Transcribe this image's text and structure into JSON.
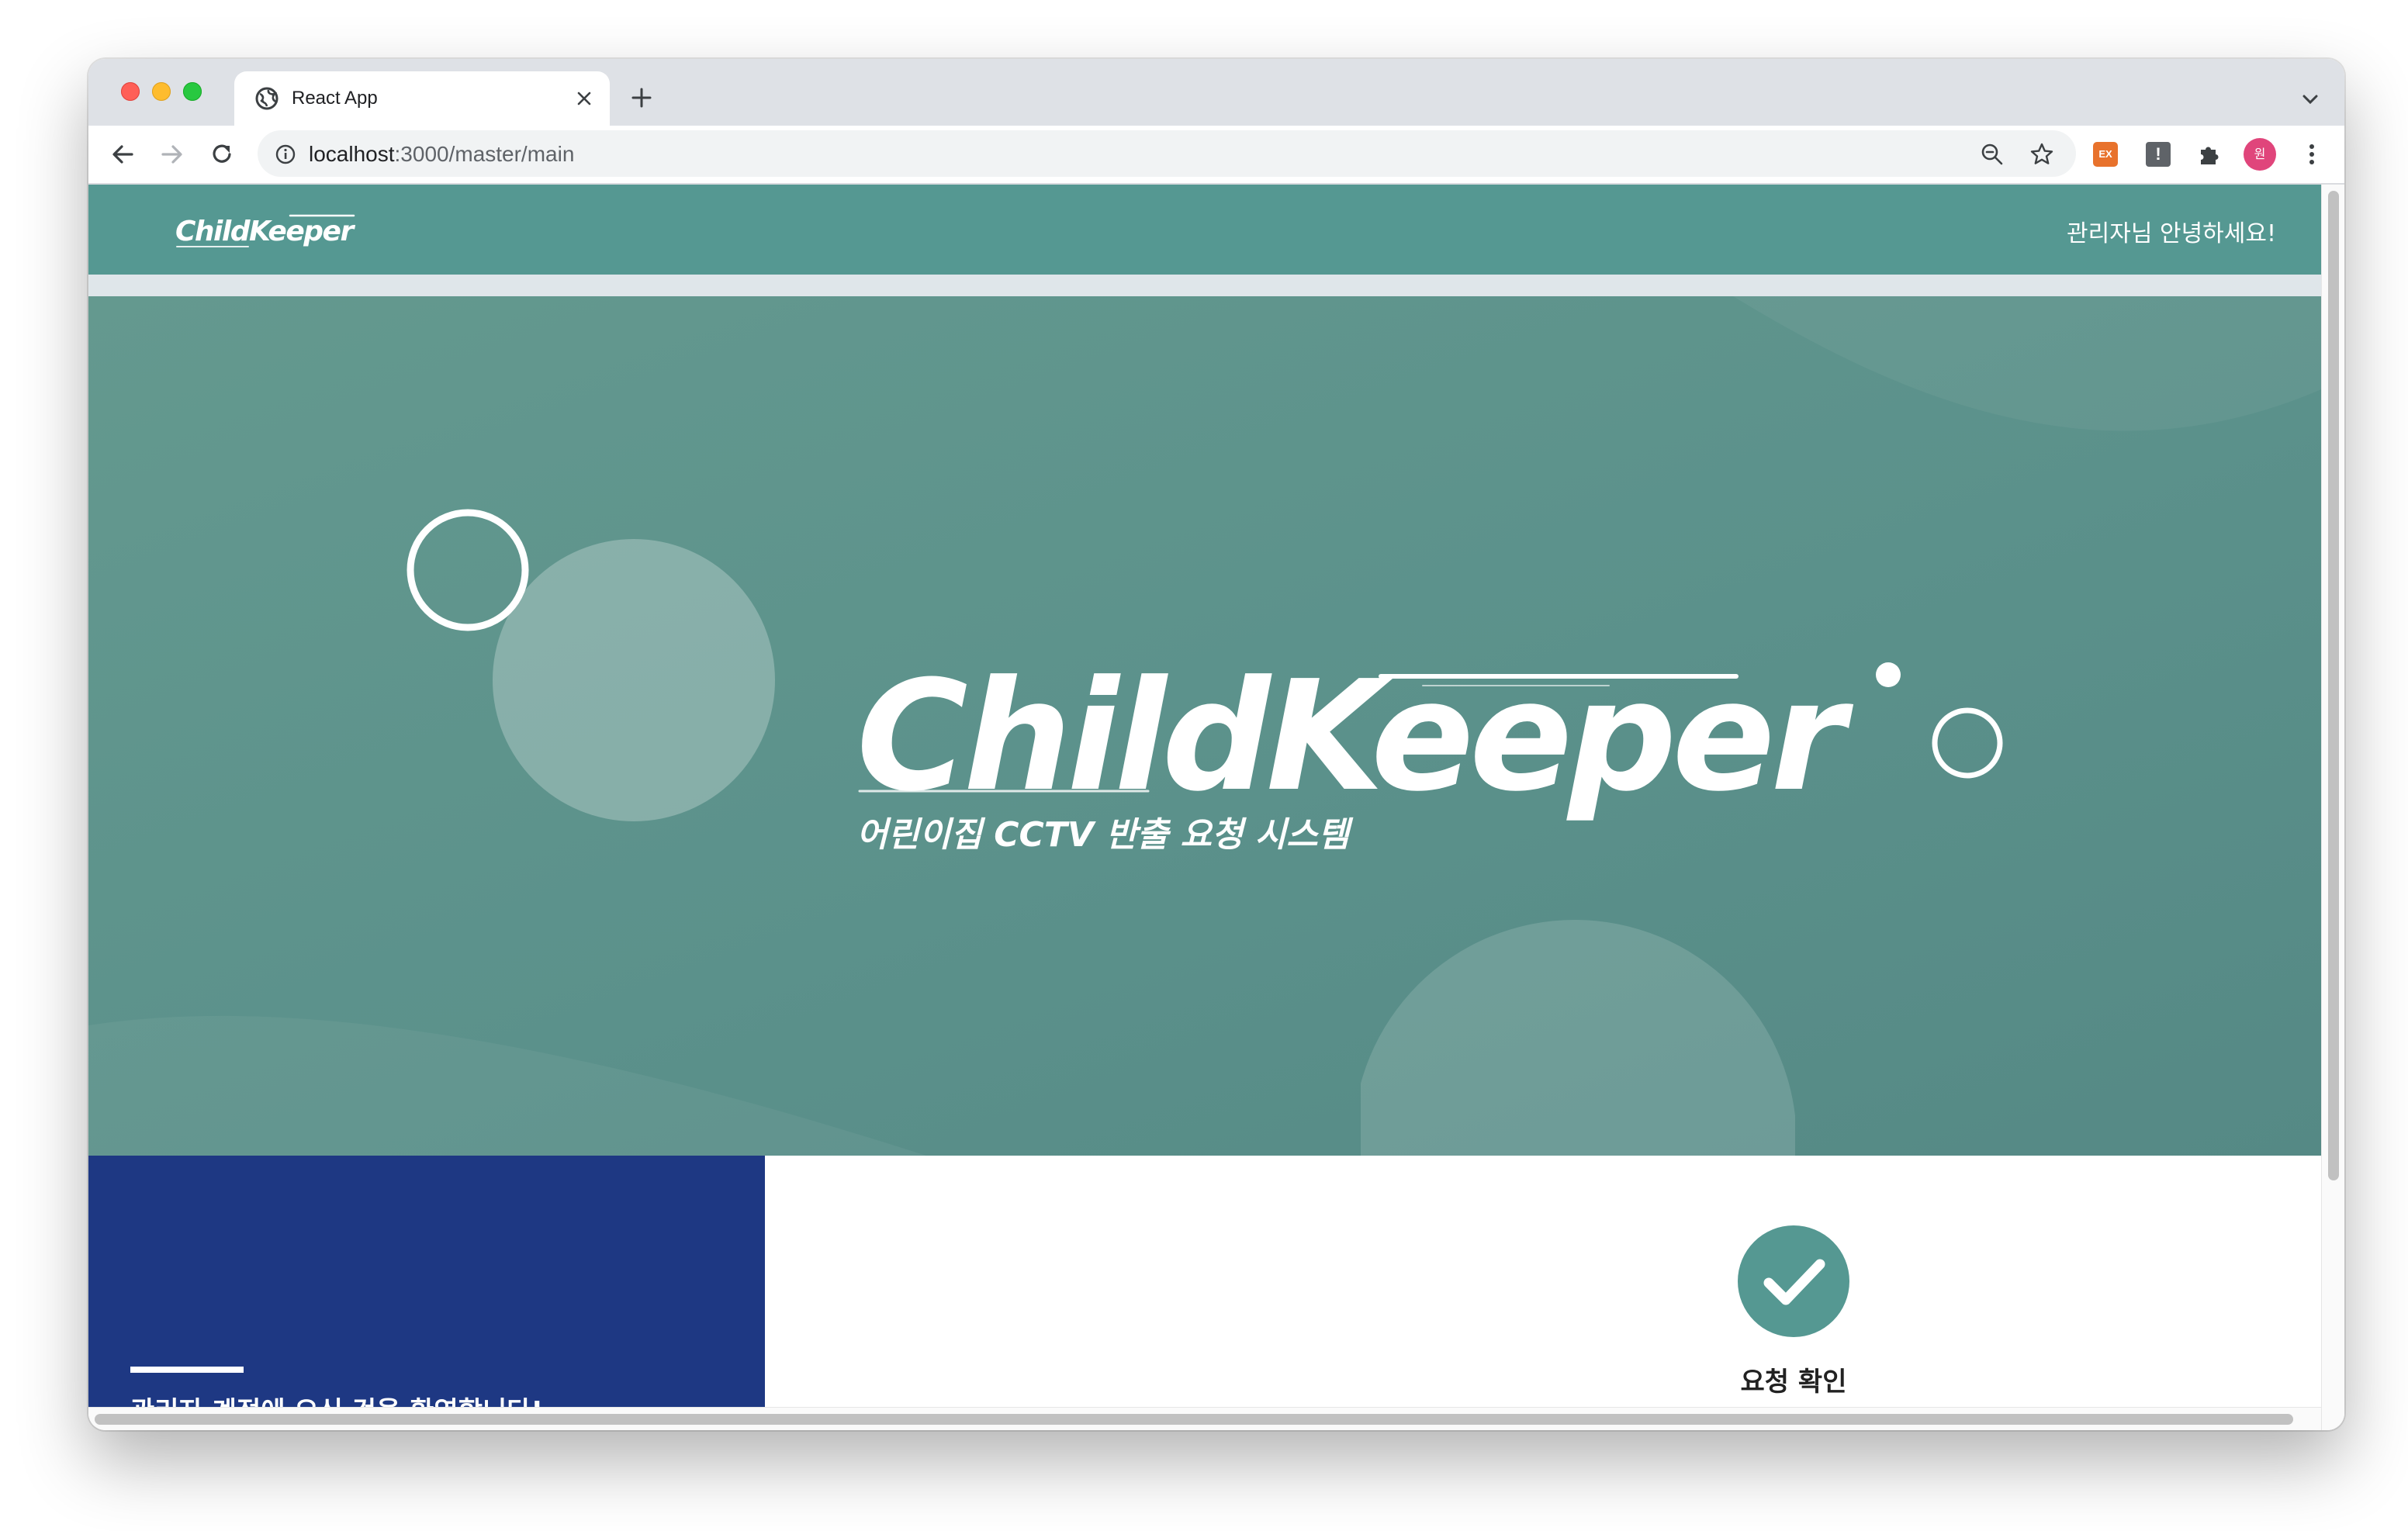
{
  "browser": {
    "tab_title": "React App",
    "url_host": "localhost",
    "url_path": ":3000/master/main",
    "avatar_initial": "원",
    "extension_ex_label": "EX",
    "extension_bang_label": "!"
  },
  "app": {
    "logo_text": "ChildKeeper",
    "greeting": "관리자님 안녕하세요!",
    "accent_color": "#559892",
    "hero": {
      "title": "ChildKeeper",
      "subtitle": "어린이집 CCTV 반출 요청 시스템"
    },
    "welcome_panel": {
      "text": "관리자 계정에 오신 것을 환영합니다!",
      "color": "#1e3883"
    },
    "feature": {
      "icon": "check-icon",
      "label": "요청 확인"
    }
  }
}
